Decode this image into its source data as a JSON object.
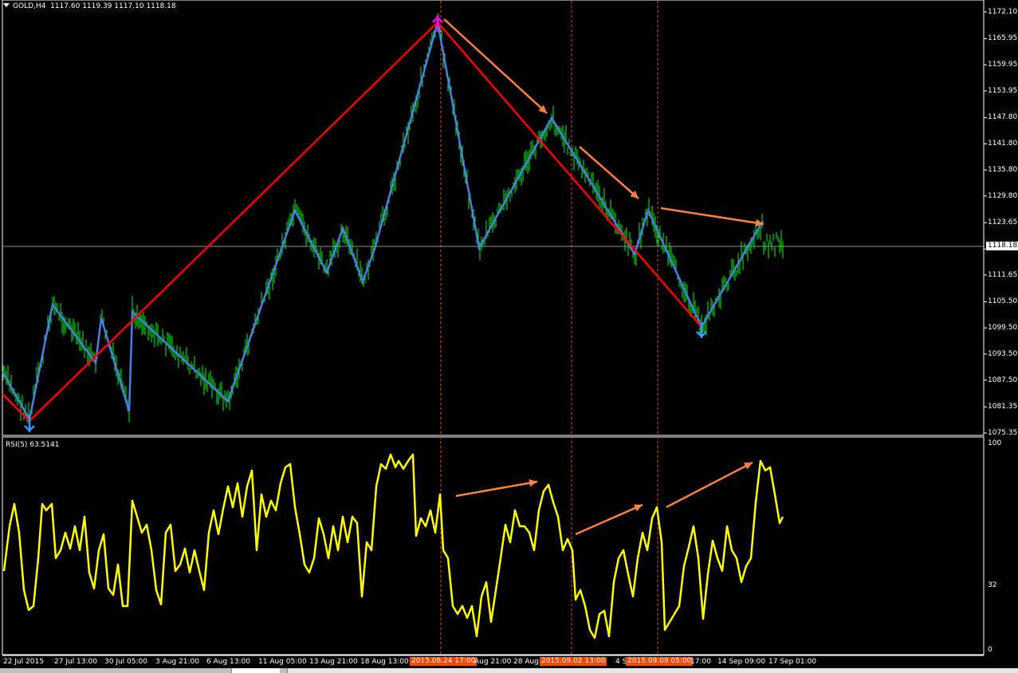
{
  "header": {
    "symbol": "GOLD,H4",
    "open": "1117.60",
    "high": "1119.39",
    "low": "1117.10",
    "close": "1118.18"
  },
  "rsi_header": {
    "label": "RSI(5) 63.5141"
  },
  "current_price": "1118.18",
  "price_axis": [
    "1172.10",
    "1165.95",
    "1159.95",
    "1153.95",
    "1147.80",
    "1141.80",
    "1135.80",
    "1129.80",
    "1123.65",
    "1117.65",
    "1111.65",
    "1105.50",
    "1099.50",
    "1093.50",
    "1087.50",
    "1081.35",
    "1075.35"
  ],
  "rsi_axis": [
    "100",
    "32",
    "0"
  ],
  "time_axis": [
    "22 Jul 2015",
    "27 Jul 13:00",
    "30 Jul 05:00",
    "3 Aug 21:00",
    "6 Aug 13:00",
    "11 Aug 05:00",
    "13 Aug 21:00",
    "18 Aug 13:00",
    "Aug 21:00",
    "28 Aug",
    "4 S",
    "17:00",
    "14 Sep 09:00",
    "17 Sep 01:00"
  ],
  "time_markers": [
    "2015.08.24 17:00",
    "2015.09.02 13:00",
    "2015.09.09 05:00"
  ],
  "colors": {
    "background": "#000000",
    "candles": "#00ff00",
    "zigzag_major": "#ff0000",
    "zigzag_minor": "#4a7de8",
    "arrows": "#ff7f3f",
    "rsi": "#ffff00",
    "marker_high": "#ff00ff",
    "marker_low": "#3399ff",
    "vline": "#ff4500"
  },
  "chart_data": {
    "type": "candlestick",
    "symbol": "GOLD",
    "timeframe": "H4",
    "ylim": [
      1075.35,
      1172.1
    ],
    "zigzag_major": [
      {
        "x": "2015-07-22",
        "y": 1077
      },
      {
        "x": "2015-08-24 17:00",
        "y": 1170
      },
      {
        "x": "2015-09-11",
        "y": 1098
      }
    ],
    "zigzag_minor": [
      {
        "x": "2015-07-20",
        "y": 1089
      },
      {
        "x": "2015-07-22",
        "y": 1077
      },
      {
        "x": "2015-07-24",
        "y": 1104
      },
      {
        "x": "2015-07-27",
        "y": 1091
      },
      {
        "x": "2015-07-28",
        "y": 1100
      },
      {
        "x": "2015-07-30",
        "y": 1080
      },
      {
        "x": "2015-07-30 05:00",
        "y": 1102
      },
      {
        "x": "2015-08-06",
        "y": 1082
      },
      {
        "x": "2015-08-10",
        "y": 1126
      },
      {
        "x": "2015-08-12",
        "y": 1112
      },
      {
        "x": "2015-08-13",
        "y": 1123
      },
      {
        "x": "2015-08-14",
        "y": 1110
      },
      {
        "x": "2015-08-18",
        "y": 1118
      },
      {
        "x": "2015-08-24 17:00",
        "y": 1170
      },
      {
        "x": "2015-08-27",
        "y": 1118
      },
      {
        "x": "2015-09-02",
        "y": 1147
      },
      {
        "x": "2015-09-07",
        "y": 1117
      },
      {
        "x": "2015-09-08",
        "y": 1126
      },
      {
        "x": "2015-09-11",
        "y": 1098
      },
      {
        "x": "2015-09-16",
        "y": 1124
      }
    ],
    "rsi": {
      "period": 5,
      "last": 63.5141,
      "ylim": [
        0,
        100
      ]
    }
  }
}
